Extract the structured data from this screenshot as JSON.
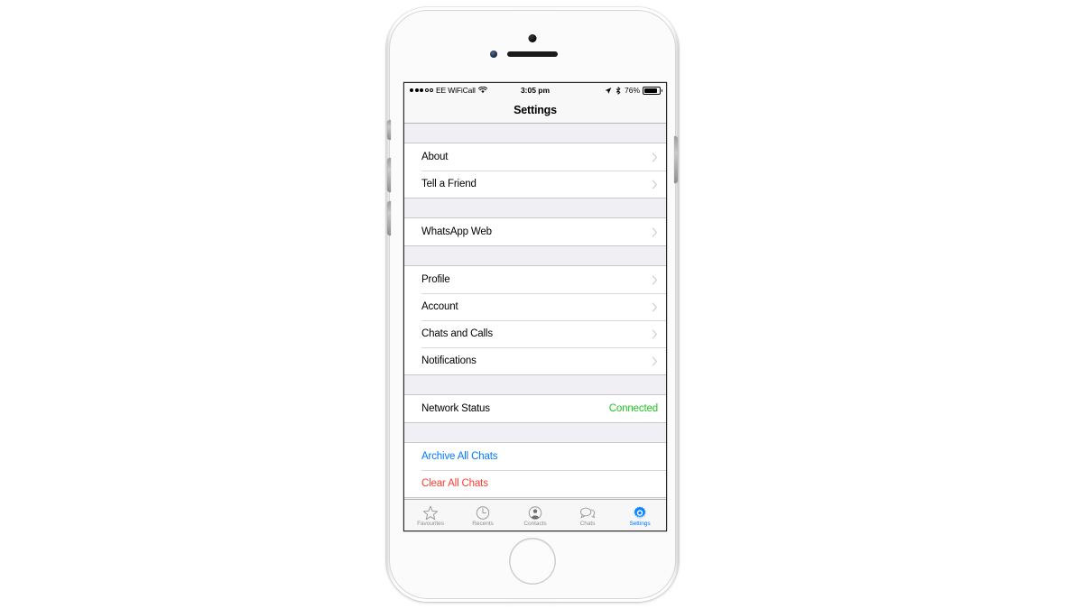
{
  "device": {
    "name": "white-iphone",
    "camera": "front-camera",
    "speaker": "earpiece-speaker",
    "sensor": "ambient-light-sensor",
    "home_button": "home-button",
    "buttons": [
      "mute-switch",
      "volume-up-button",
      "volume-down-button",
      "power-button"
    ]
  },
  "status_bar": {
    "signal_dots_filled": 3,
    "signal_dots_total": 5,
    "carrier": "EE WiFiCall",
    "wifi_icon": "wifi-icon",
    "time": "3:05 pm",
    "location_icon": "location-arrow-icon",
    "bluetooth_icon": "bluetooth-icon",
    "battery_percent": "76%",
    "battery_level": 76
  },
  "nav_bar": {
    "title": "Settings"
  },
  "colors": {
    "accent_blue": "#007aff",
    "destructive_red": "#ff3b30",
    "connected_green": "#22c522",
    "table_background": "#efeff4",
    "cell_background": "#ffffff"
  },
  "groups": [
    {
      "id": "group-info",
      "rows": [
        {
          "label": "About",
          "type": "disclosure",
          "icon": "chevron-right-icon"
        },
        {
          "label": "Tell a Friend",
          "type": "disclosure",
          "icon": "chevron-right-icon"
        }
      ]
    },
    {
      "id": "group-web",
      "rows": [
        {
          "label": "WhatsApp Web",
          "type": "disclosure",
          "icon": "chevron-right-icon"
        }
      ]
    },
    {
      "id": "group-account",
      "rows": [
        {
          "label": "Profile",
          "type": "disclosure",
          "icon": "chevron-right-icon"
        },
        {
          "label": "Account",
          "type": "disclosure",
          "icon": "chevron-right-icon"
        },
        {
          "label": "Chats and Calls",
          "type": "disclosure",
          "icon": "chevron-right-icon"
        },
        {
          "label": "Notifications",
          "type": "disclosure",
          "icon": "chevron-right-icon"
        }
      ]
    },
    {
      "id": "group-network",
      "rows": [
        {
          "label": "Network Status",
          "type": "value",
          "value": "Connected",
          "value_color": "#22c522"
        }
      ]
    },
    {
      "id": "group-actions",
      "rows": [
        {
          "label": "Archive All Chats",
          "type": "action",
          "style": "blue"
        },
        {
          "label": "Clear All Chats",
          "type": "action",
          "style": "red"
        }
      ]
    }
  ],
  "tab_bar": {
    "active": "Settings",
    "tabs": [
      {
        "label": "Favourites",
        "icon": "star-icon"
      },
      {
        "label": "Recents",
        "icon": "clock-icon"
      },
      {
        "label": "Contacts",
        "icon": "person-icon"
      },
      {
        "label": "Chats",
        "icon": "speech-bubble-icon"
      },
      {
        "label": "Settings",
        "icon": "gear-icon"
      }
    ]
  }
}
